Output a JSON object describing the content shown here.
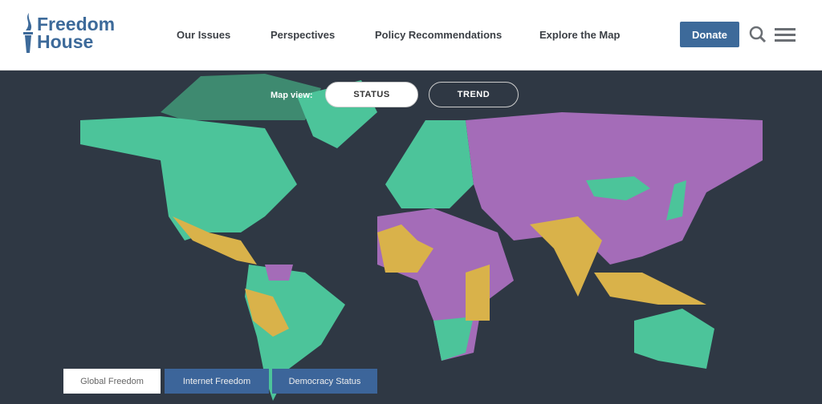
{
  "logo": {
    "line1": "Freedom",
    "line2": "House"
  },
  "nav": [
    {
      "label": "Our Issues"
    },
    {
      "label": "Perspectives"
    },
    {
      "label": "Policy Recommendations"
    },
    {
      "label": "Explore the Map"
    }
  ],
  "donate": "Donate",
  "map_view": {
    "label": "Map view:",
    "options": [
      {
        "label": "STATUS",
        "selected": true
      },
      {
        "label": "TREND",
        "selected": false
      }
    ]
  },
  "tabs": [
    {
      "label": "Global Freedom",
      "active": true
    },
    {
      "label": "Internet Freedom",
      "active": false
    },
    {
      "label": "Democracy Status",
      "active": false
    }
  ],
  "colors": {
    "free": "#4cc49a",
    "partly_free": "#d9b24a",
    "not_free": "#a46cb8",
    "background": "#2f3844",
    "brand": "#3d6a9a"
  }
}
